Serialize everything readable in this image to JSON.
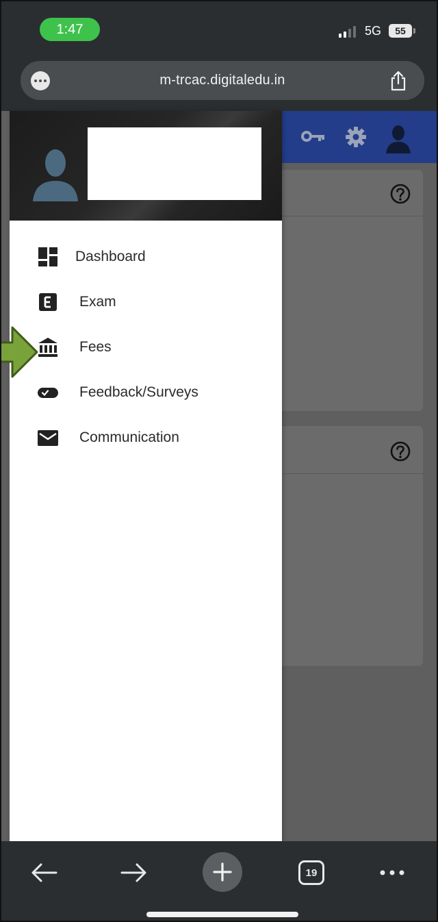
{
  "status_bar": {
    "time": "1:47",
    "network": "5G",
    "battery": "55",
    "time_pill_color": "#3ec24c"
  },
  "browser": {
    "url": "m-trcac.digitaledu.in",
    "tab_count": "19",
    "icons": {
      "menu": "ellipsis-circle-icon",
      "share": "share-icon",
      "back": "arrow-left-icon",
      "forward": "arrow-right-icon",
      "new_tab": "plus-icon",
      "tabs": "tabs-icon",
      "more": "more-dots-icon"
    }
  },
  "app": {
    "header_color": "#233d8a",
    "header_icons": [
      "key-icon",
      "gear-icon",
      "user-icon"
    ],
    "cards": [
      {
        "help_icon": "help-circle-icon"
      },
      {
        "help_icon": "help-circle-icon"
      }
    ]
  },
  "drawer": {
    "profile_name": "",
    "menu_items": [
      {
        "label": "Dashboard",
        "icon": "dashboard-icon"
      },
      {
        "label": "Exam",
        "icon": "exam-icon"
      },
      {
        "label": "Fees",
        "icon": "bank-icon"
      },
      {
        "label": "Feedback/Surveys",
        "icon": "feedback-toggle-icon"
      },
      {
        "label": "Communication",
        "icon": "mail-icon"
      }
    ]
  },
  "annotation": {
    "arrow_color": "#7aa23a",
    "points_to": "Fees"
  }
}
